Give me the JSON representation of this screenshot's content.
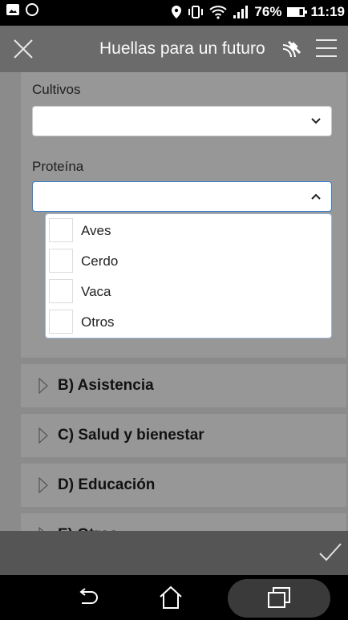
{
  "status_bar": {
    "battery_text": "76%",
    "time": "11:19",
    "icons": [
      "gallery-icon",
      "whatsapp-icon",
      "location-icon",
      "vibrate-icon",
      "wifi-icon",
      "signal-icon",
      "battery-icon"
    ]
  },
  "app_bar": {
    "title": "Huellas para un futuro",
    "icons": [
      "close-icon",
      "satellite-icon",
      "menu-icon"
    ]
  },
  "form": {
    "cultivos_label": "Cultivos",
    "cultivos_value": "",
    "proteina_label": "Proteína",
    "proteina_value": "",
    "proteina_options": [
      "Aves",
      "Cerdo",
      "Vaca",
      "Otros"
    ]
  },
  "sections": [
    "B) Asistencia",
    "C) Salud y bienestar",
    "D) Educación",
    "E) Otros"
  ],
  "colors": {
    "header": "#6b6b6b",
    "overlay": "#8b8b8b",
    "dropdown_border": "#3a7fd0"
  }
}
